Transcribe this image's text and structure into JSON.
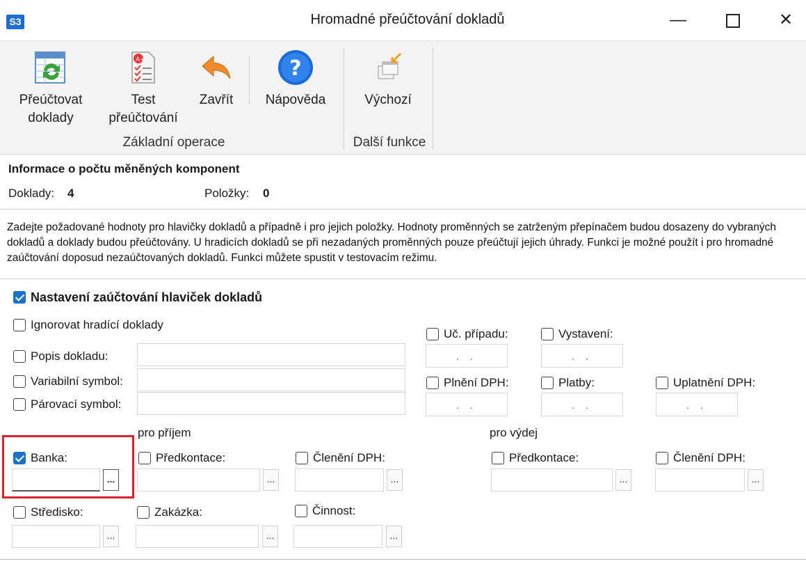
{
  "window": {
    "app_logo": "S3",
    "title": "Hromadné přeúčtování dokladů",
    "minimize_icon": "minimize-icon",
    "maximize_icon": "maximize-icon",
    "close_icon": "close-icon"
  },
  "ribbon": {
    "buttons": [
      {
        "line1": "Přeúčtovat",
        "line2": "doklady",
        "icon": "recalculate-icon"
      },
      {
        "line1": "Test",
        "line2": "přeúčtování",
        "icon": "test-icon"
      },
      {
        "line1": "Zavřít",
        "line2": "",
        "icon": "undo-arrow-icon"
      },
      {
        "line1": "Nápověda",
        "line2": "",
        "icon": "help-icon"
      },
      {
        "line1": "Výchozí",
        "line2": "",
        "icon": "default-icon"
      }
    ],
    "groups": [
      "Základní operace",
      "Další funkce"
    ]
  },
  "info": {
    "heading": "Informace o počtu měněných komponent",
    "doklady_label": "Doklady:",
    "doklady_value": "4",
    "polozky_label": "Položky:",
    "polozky_value": "0"
  },
  "description": "Zadejte požadované hodnoty pro hlavičky dokladů a případně i pro jejich položky. Hodnoty proměnných se zatrženým přepínačem budou dosazeny do vybraných dokladů a doklady budou přeúčtovány. U hradicích dokladů se při nezadaných proměnných pouze přeúčtují jejich úhrady. Funkci je možné použít i pro hromadné zaúčtování doposud nezaúčtovaných dokladů. Funkci můžete spustit v testovacím režimu.",
  "settings": {
    "section_label": "Nastavení zaúčtování hlaviček dokladů",
    "section_checked": true,
    "ignore_label": "Ignorovat hradící doklady",
    "popis_label": "Popis dokladu:",
    "variabilni_label": "Variabilní symbol:",
    "parovaci_label": "Párovací symbol:",
    "uc_pripadu_label": "Uč. případu:",
    "vystaveni_label": "Vystavení:",
    "plneni_label": "Plnění DPH:",
    "platby_label": "Platby:",
    "uplatneni_label": "Uplatnění DPH:",
    "date_placeholder": ". .",
    "pro_prijem": "pro příjem",
    "pro_vydej": "pro výdej",
    "banka_label": "Banka:",
    "banka_checked": true,
    "predkontace_label": "Předkontace:",
    "cleneni_label": "Členění DPH:",
    "stredisko_label": "Středisko:",
    "zakazka_label": "Zakázka:",
    "cinnost_label": "Činnost:",
    "browse_label": "..."
  }
}
